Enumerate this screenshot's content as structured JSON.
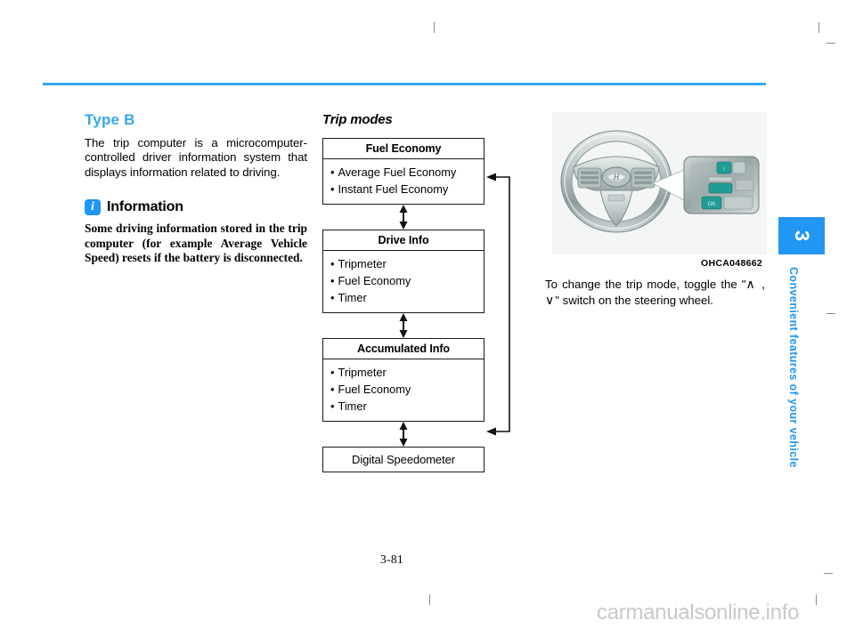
{
  "page": {
    "number": "3-81",
    "watermark": "carmanualsonline.info"
  },
  "side_tab": {
    "chapter_number": "3",
    "chapter_title": "Convenient features of your vehicle",
    "color": "#2196f3"
  },
  "rule_color": "#35a8ef",
  "left_column": {
    "heading": "Type B",
    "heading_color": "#35a8ef",
    "paragraph": "The trip computer is a microcomputer-controlled driver information system that displays information related to driving.",
    "information": {
      "icon": "info-icon",
      "icon_letter": "i",
      "title": "Information",
      "body": "Some driving information stored in the trip computer (for example Average Vehicle Speed) resets if the battery is disconnected."
    }
  },
  "flowchart": {
    "title": "Trip modes",
    "boxes": [
      {
        "header": "Fuel Economy",
        "items": [
          "Average Fuel Economy",
          "Instant Fuel Economy"
        ]
      },
      {
        "header": "Drive Info",
        "items": [
          "Tripmeter",
          "Fuel Economy",
          "Timer"
        ]
      },
      {
        "header": "Accumulated Info",
        "items": [
          "Tripmeter",
          "Fuel Economy",
          "Timer"
        ]
      },
      {
        "header": "Digital Speedometer",
        "items": []
      }
    ]
  },
  "right_column": {
    "photo": {
      "alt": "steering-wheel-with-remote-control-switches",
      "caption": "OHCA048662"
    },
    "paragraph_before": "To change the trip mode, toggle the \"",
    "switch_glyphs": "∧ , ∨",
    "paragraph_after": "\" switch on the steering wheel."
  }
}
